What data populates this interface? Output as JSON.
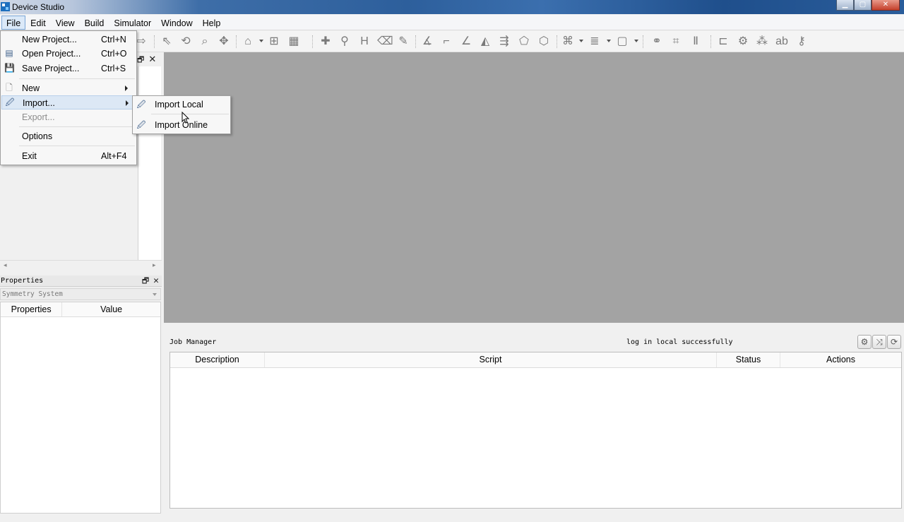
{
  "window": {
    "title": "Device Studio"
  },
  "menubar": [
    "File",
    "Edit",
    "View",
    "Build",
    "Simulator",
    "Window",
    "Help"
  ],
  "file_menu": {
    "items": [
      {
        "label": "New Project...",
        "shortcut": "Ctrl+N",
        "icon": "blank-icon"
      },
      {
        "label": "Open Project...",
        "shortcut": "Ctrl+O",
        "icon": "open-project-icon"
      },
      {
        "label": "Save Project...",
        "shortcut": "Ctrl+S",
        "icon": "save-icon"
      },
      {
        "label": "New",
        "shortcut": "",
        "icon": "new-file-icon",
        "submenu": true
      },
      {
        "label": "Import...",
        "shortcut": "",
        "icon": "import-icon",
        "submenu": true
      },
      {
        "label": "Export...",
        "shortcut": "",
        "disabled": true
      },
      {
        "label": "Options",
        "shortcut": ""
      },
      {
        "label": "Exit",
        "shortcut": "Alt+F4"
      }
    ]
  },
  "import_submenu": {
    "items": [
      {
        "label": "Import Local",
        "icon": "import-icon"
      },
      {
        "label": "Import Online",
        "icon": "import-icon"
      }
    ]
  },
  "properties": {
    "title": "Properties",
    "symmetry": "Symmetry System",
    "columns": [
      "Properties",
      "Value"
    ]
  },
  "job_manager": {
    "title": "Job Manager",
    "status": "log in local successfully",
    "columns": [
      "Description",
      "Script",
      "Status",
      "Actions"
    ]
  }
}
